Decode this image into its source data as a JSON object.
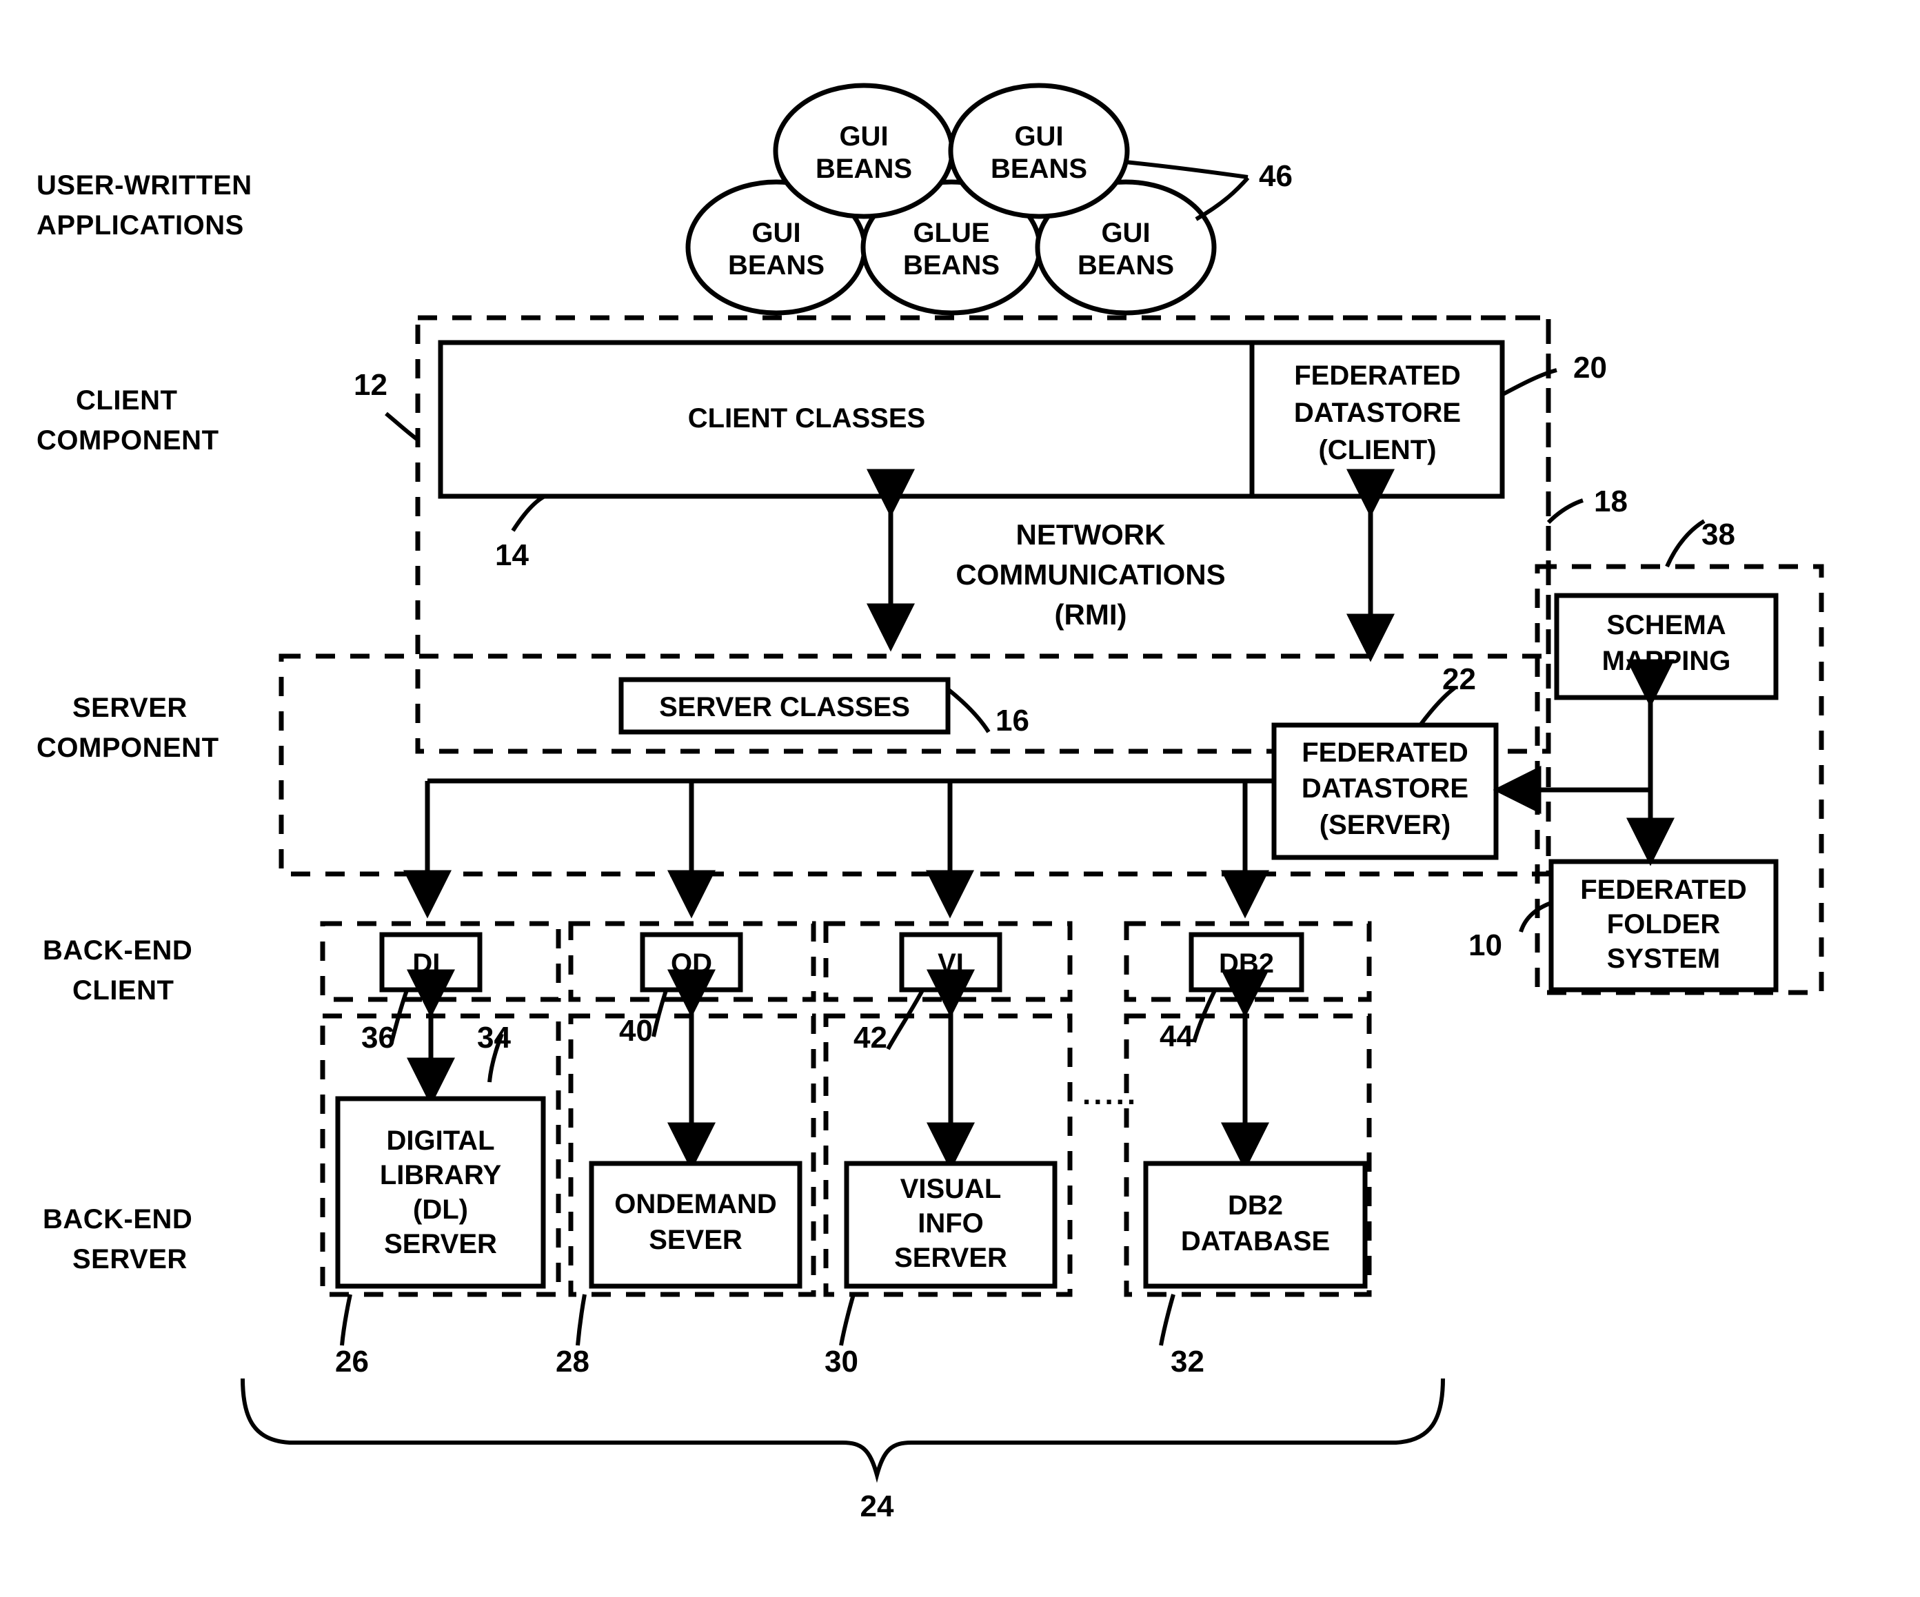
{
  "figure": {
    "type": "patent-block-diagram",
    "background": "#ffffff",
    "ink": "#000000"
  },
  "row_labels": [
    {
      "id": "user-written-applications",
      "line1": "USER-WRITTEN",
      "line2": "APPLICATIONS"
    },
    {
      "id": "client-component",
      "line1": "CLIENT",
      "line2": "COMPONENT"
    },
    {
      "id": "server-component",
      "line1": "SERVER",
      "line2": "COMPONENT"
    },
    {
      "id": "back-end-client",
      "line1": "BACK-END",
      "line2": "CLIENT"
    },
    {
      "id": "back-end-server",
      "line1": "BACK-END",
      "line2": "SERVER"
    }
  ],
  "beans": [
    {
      "id": "gui-beans-top-left",
      "line1": "GUI",
      "line2": "BEANS"
    },
    {
      "id": "gui-beans-top-right",
      "line1": "GUI",
      "line2": "BEANS"
    },
    {
      "id": "gui-beans-bottom-left",
      "line1": "GUI",
      "line2": "BEANS"
    },
    {
      "id": "glue-beans",
      "line1": "GLUE",
      "line2": "BEANS"
    },
    {
      "id": "gui-beans-bottom-right",
      "line1": "GUI",
      "line2": "BEANS"
    }
  ],
  "boxes": {
    "client_classes": {
      "label": "CLIENT CLASSES"
    },
    "federated_datastore_client": {
      "line1": "FEDERATED",
      "line2": "DATASTORE",
      "line3": "(CLIENT)"
    },
    "server_classes": {
      "label": "SERVER CLASSES"
    },
    "federated_datastore_server": {
      "line1": "FEDERATED",
      "line2": "DATASTORE",
      "line3": "(SERVER)"
    },
    "schema_mapping": {
      "line1": "SCHEMA",
      "line2": "MAPPING"
    },
    "federated_folder_system": {
      "line1": "FEDERATED",
      "line2": "FOLDER",
      "line3": "SYSTEM"
    },
    "dl_client": {
      "label": "DL"
    },
    "od_client": {
      "label": "OD"
    },
    "vi_client": {
      "label": "VI"
    },
    "db2_client": {
      "label": "DB2"
    },
    "dl_server": {
      "line1": "DIGITAL",
      "line2": "LIBRARY",
      "line3": "(DL)",
      "line4": "SERVER"
    },
    "od_server": {
      "line1": "ONDEMAND",
      "line2": "SEVER"
    },
    "vi_server": {
      "line1": "VISUAL",
      "line2": "INFO",
      "line3": "SERVER"
    },
    "db2_server": {
      "line1": "DB2",
      "line2": "DATABASE"
    }
  },
  "annotations": {
    "network_communications": {
      "line1": "NETWORK",
      "line2": "COMMUNICATIONS",
      "line3": "(RMI)"
    },
    "ellipsis": "....."
  },
  "reference_numbers": [
    {
      "id": "ref-46",
      "value": "46",
      "refers_to": "user-written-applications-bean-cluster"
    },
    {
      "id": "ref-12",
      "value": "12",
      "refers_to": "client-component-boundary"
    },
    {
      "id": "ref-14",
      "value": "14",
      "refers_to": "client-classes"
    },
    {
      "id": "ref-20",
      "value": "20",
      "refers_to": "federated-datastore-client"
    },
    {
      "id": "ref-18",
      "value": "18",
      "refers_to": "federated-datastore-boundary"
    },
    {
      "id": "ref-16",
      "value": "16",
      "refers_to": "server-classes"
    },
    {
      "id": "ref-22",
      "value": "22",
      "refers_to": "federated-datastore-server"
    },
    {
      "id": "ref-38",
      "value": "38",
      "refers_to": "schema-mapping-group"
    },
    {
      "id": "ref-10",
      "value": "10",
      "refers_to": "federated-folder-system"
    },
    {
      "id": "ref-36",
      "value": "36",
      "refers_to": "dl-client"
    },
    {
      "id": "ref-34",
      "value": "34",
      "refers_to": "digital-library-server"
    },
    {
      "id": "ref-40",
      "value": "40",
      "refers_to": "od-client"
    },
    {
      "id": "ref-42",
      "value": "42",
      "refers_to": "vi-client"
    },
    {
      "id": "ref-44",
      "value": "44",
      "refers_to": "db2-client"
    },
    {
      "id": "ref-26",
      "value": "26",
      "refers_to": "dl-group"
    },
    {
      "id": "ref-28",
      "value": "28",
      "refers_to": "od-group"
    },
    {
      "id": "ref-30",
      "value": "30",
      "refers_to": "vi-group"
    },
    {
      "id": "ref-32",
      "value": "32",
      "refers_to": "db2-group"
    },
    {
      "id": "ref-24",
      "value": "24",
      "refers_to": "all-back-end-systems-brace"
    }
  ]
}
